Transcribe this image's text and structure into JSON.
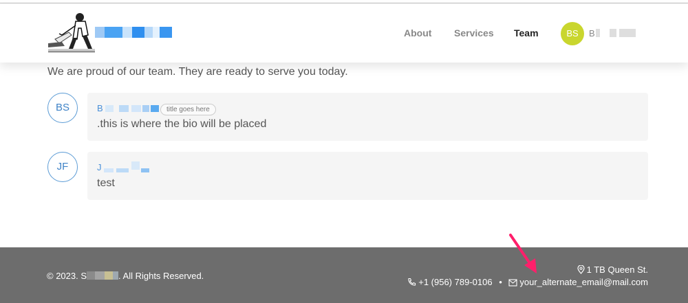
{
  "header": {
    "brand_name": "",
    "nav": [
      {
        "label": "About"
      },
      {
        "label": "Services"
      },
      {
        "label": "Team"
      }
    ],
    "user": {
      "initials": "BS",
      "name": "B",
      "avatar_color": "#c9d62e"
    }
  },
  "main": {
    "intro": "We are proud of our team. They are ready to serve you today.",
    "members": [
      {
        "initials": "BS",
        "name": "B",
        "title": "title goes here",
        "bio": ".this is where the bio will be placed"
      },
      {
        "initials": "JF",
        "name": "J",
        "title": "",
        "bio": "test"
      }
    ]
  },
  "footer": {
    "copyright_prefix": "© 2023. S",
    "copyright_suffix": ". All Rights Reserved.",
    "address": "1 TB Queen St.",
    "phone": "+1 (956) 789-0106",
    "separator": "•",
    "email": "your_alternate_email@mail.com",
    "background": "#6d6d6d"
  },
  "colors": {
    "accent": "#4a90d9",
    "annotation_arrow": "#ff1f6b"
  }
}
